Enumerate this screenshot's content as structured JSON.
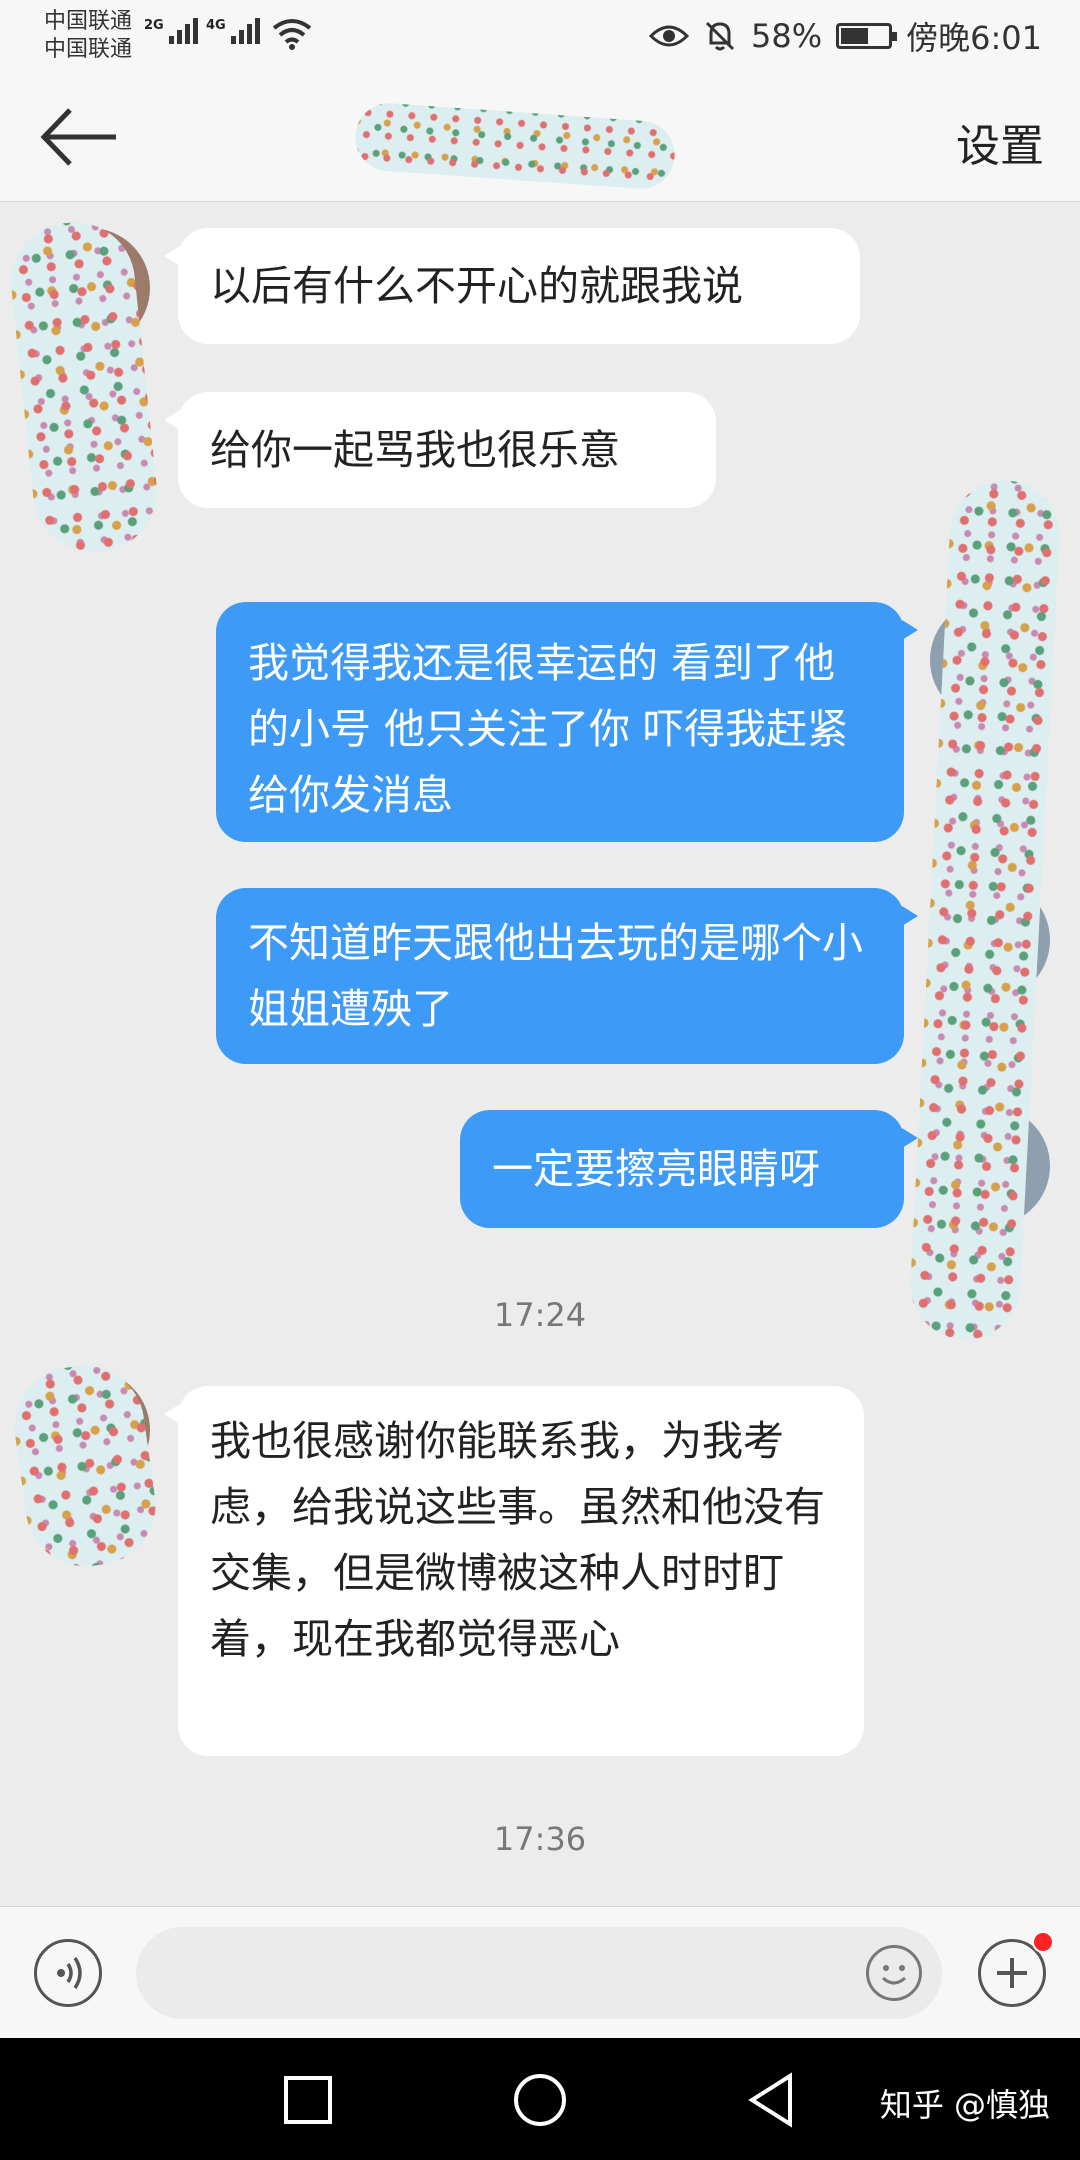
{
  "status_bar": {
    "carrier_1": "中国联通",
    "carrier_2": "中国联通",
    "net_1": "2G",
    "net_2": "4G",
    "battery_percent": "58%",
    "battery_level": 0.58,
    "time": "傍晚6:01"
  },
  "header": {
    "title": "...",
    "settings_label": "设置"
  },
  "messages": [
    {
      "side": "in",
      "text": "以后有什么不开心的就跟我说"
    },
    {
      "side": "in",
      "text": "给你一起骂我也很乐意"
    },
    {
      "side": "out",
      "text": "我觉得我还是很幸运的 看到了他的小号 他只关注了你 吓得我赶紧给你发消息"
    },
    {
      "side": "out",
      "text": "不知道昨天跟他出去玩的是哪个小姐姐遭殃了"
    },
    {
      "side": "out",
      "text": "一定要擦亮眼睛呀"
    },
    {
      "side": "in",
      "text": "我也很感谢你能联系我，为我考虑，给我说这些事。虽然和他没有交集，但是微博被这种人时时盯着，现在我都觉得恶心"
    }
  ],
  "timestamps": [
    "17:24",
    "17:36"
  ],
  "input": {
    "value": "",
    "placeholder": ""
  },
  "icons": {
    "back": "arrow-left-icon",
    "voice": "voice-icon",
    "emoji": "emoji-icon",
    "plus": "plus-icon",
    "eye": "eye-icon",
    "bell_off": "bell-off-icon",
    "wifi": "wifi-icon"
  },
  "colors": {
    "outgoing_bubble": "#3d9bf7",
    "incoming_bubble": "#ffffff",
    "background": "#ececec",
    "notification_dot": "#ff2222"
  },
  "watermark": "知乎 @慎独"
}
